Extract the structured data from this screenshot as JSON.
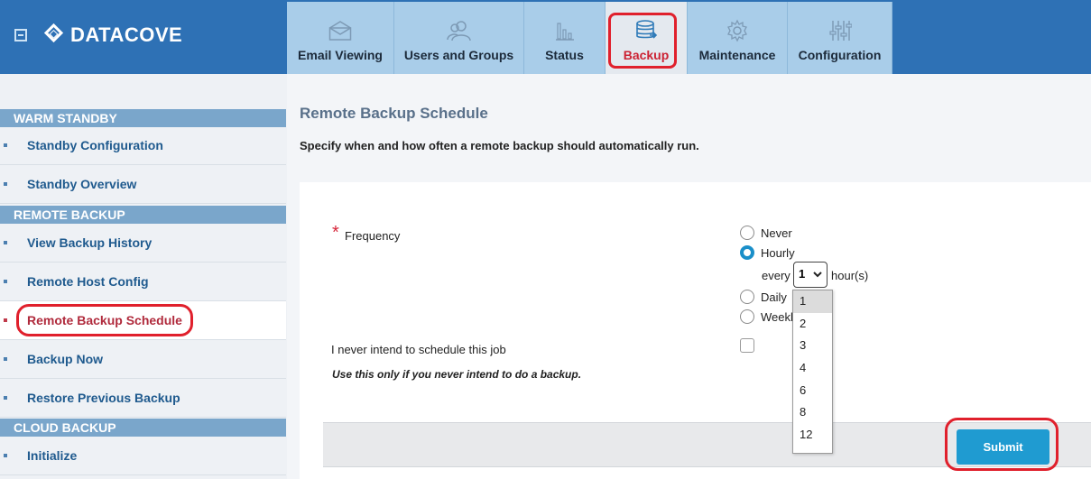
{
  "brand": {
    "name": "DATACOVE"
  },
  "tabs": [
    {
      "label": "Email Viewing",
      "icon": "envelope-icon"
    },
    {
      "label": "Users and Groups",
      "icon": "users-icon"
    },
    {
      "label": "Status",
      "icon": "bar-chart-icon"
    },
    {
      "label": "Backup",
      "icon": "database-icon",
      "active": true
    },
    {
      "label": "Maintenance",
      "icon": "gear-icon"
    },
    {
      "label": "Configuration",
      "icon": "sliders-icon"
    }
  ],
  "sidebar": {
    "sections": [
      {
        "title": "WARM STANDBY",
        "items": [
          "Standby Configuration",
          "Standby Overview"
        ]
      },
      {
        "title": "REMOTE BACKUP",
        "items": [
          "View Backup History",
          "Remote Host Config",
          "Remote Backup Schedule",
          "Backup Now",
          "Restore Previous Backup"
        ]
      },
      {
        "title": "CLOUD BACKUP",
        "items": [
          "Initialize"
        ]
      }
    ],
    "active_item": "Remote Backup Schedule"
  },
  "main": {
    "title": "Remote Backup Schedule",
    "description": "Specify when and how often a remote backup should automatically run.",
    "frequency": {
      "label": "Frequency",
      "required_mark": "*",
      "options": [
        "Never",
        "Hourly",
        "Daily",
        "Weekly"
      ],
      "options_visible": [
        "Never",
        "Hourly",
        "Daily",
        "Weekl"
      ],
      "selected": "Hourly",
      "every_label": "every",
      "hours_label": "hour(s)",
      "interval_value": "1",
      "interval_options": [
        "1",
        "2",
        "3",
        "4",
        "6",
        "8",
        "12"
      ]
    },
    "never_schedule": {
      "label": "I never intend to schedule this job",
      "checked": false,
      "hint": "Use this only if you never intend to do a backup."
    },
    "submit_label": "Submit"
  },
  "colors": {
    "header": "#2e71b5",
    "tab": "#a9cde9",
    "tab_active": "#e4e9ef",
    "section_header": "#7aa6cb",
    "accent": "#1f9bd1",
    "highlight": "#e0202c"
  }
}
